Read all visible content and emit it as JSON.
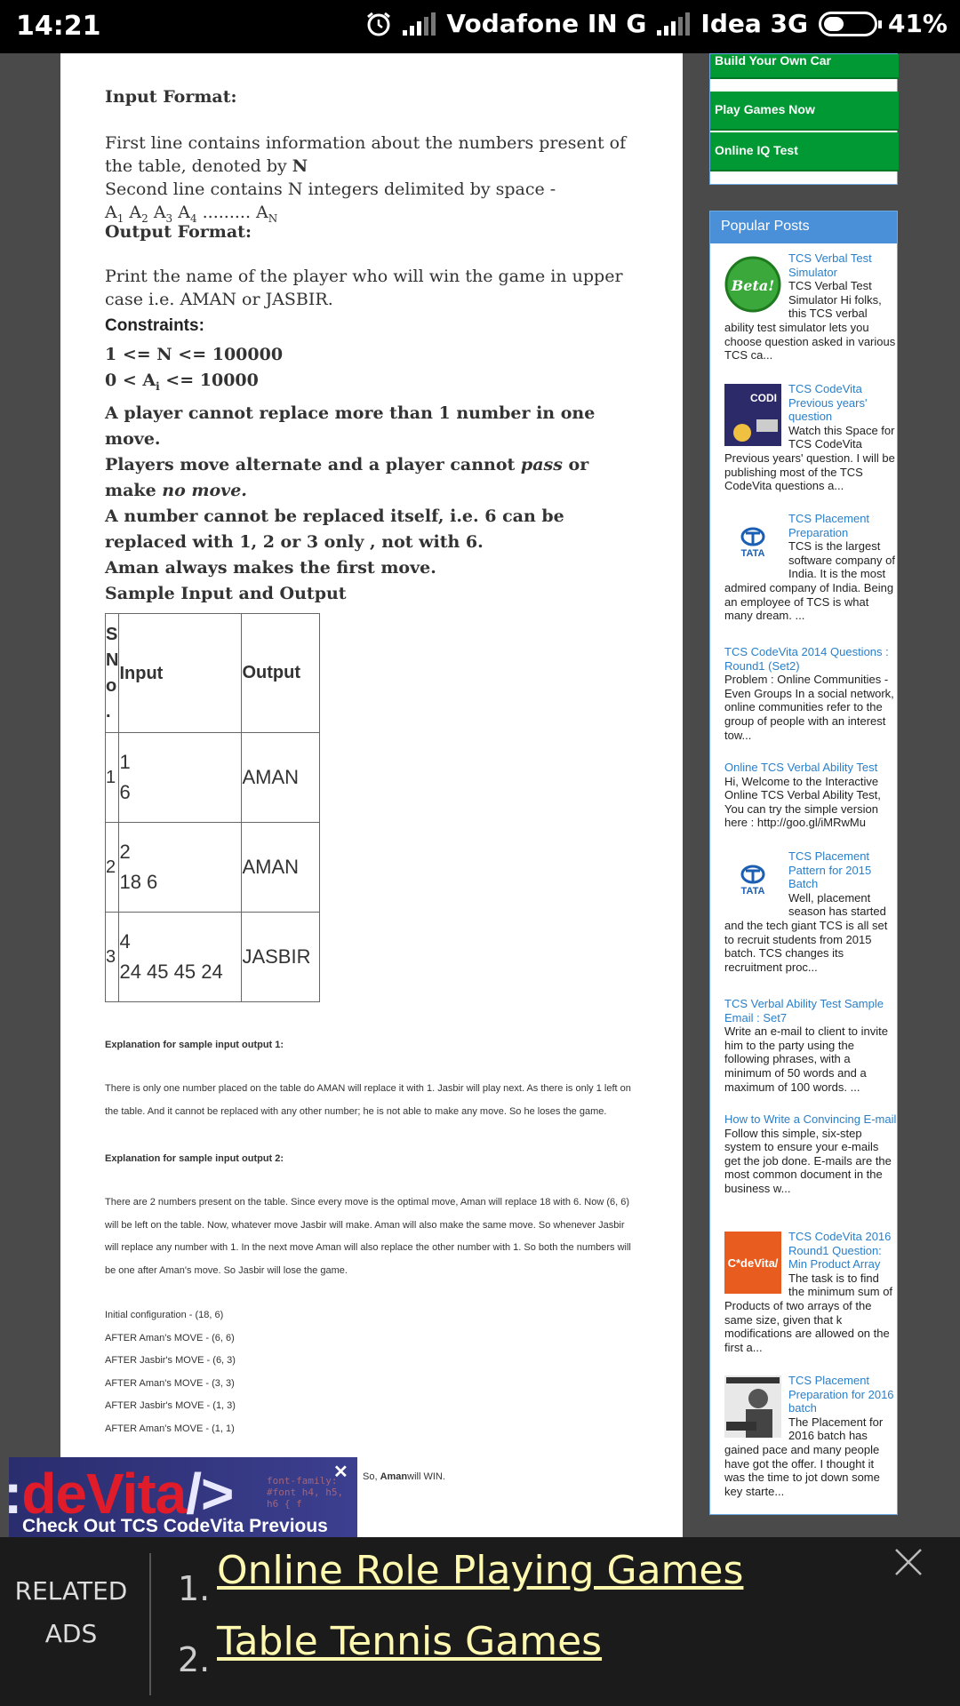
{
  "status_bar": {
    "time": "14:21",
    "carrier1": "Vodafone IN G",
    "carrier2": "Idea 3G",
    "battery": "41%",
    "battery_level": 0.41,
    "icons": [
      "alarm-icon",
      "signal-icon",
      "battery-icon"
    ]
  },
  "article": {
    "input_format_heading": "Input Format:",
    "input_line1": "First line contains information about the numbers present of the table, denoted by",
    "input_line1_var": "N",
    "input_line2": "Second line contains N integers delimited by space -",
    "input_line3": "A1 A2 A3 A4 ......... AN",
    "output_format_heading": "Output Format:",
    "output_text": "Print the name of the player who will win the game in upper case i.e. AMAN or JASBIR.",
    "constraints_heading": "Constraints:",
    "constraint1": "1 <= N <= 100000",
    "constraint2": "0 < Ai <= 10000",
    "constraint3": "A player cannot replace more than 1 number in one move.",
    "constraint4_a": "Players move alternate and a player cannot",
    "constraint4_pass": "pass",
    "constraint4_b": "or make",
    "constraint4_nomove": "no move.",
    "constraint5": "A number cannot be replaced itself, i.e. 6 can be replaced with 1, 2 or 3 only , not with 6.",
    "constraint6": "Aman always makes the first move.",
    "sample_heading": "Sample Input and Output",
    "table": {
      "headers": [
        "S N o .",
        "Input",
        "Output"
      ],
      "rows": [
        {
          "sno": "1",
          "input_line1": "1",
          "input_line2": "6",
          "output": "AMAN"
        },
        {
          "sno": "2",
          "input_line1": "2",
          "input_line2": "18 6",
          "output": "AMAN"
        },
        {
          "sno": "3",
          "input_line1": "4",
          "input_line2": "24 45 45 24",
          "output": "JASBIR"
        }
      ]
    },
    "expl1_heading": "Explanation for sample input output 1:",
    "expl1_text": "There is only one number placed on the table do AMAN will replace it with 1. Jasbir will play next. As there is only 1 left on the table. And it cannot be replaced with any other number; he is not able to make any move. So he loses the game.",
    "expl2_heading": "Explanation for sample input output 2:",
    "expl2_text": "There are 2 numbers present on the table. Since every move is the optimal move, Aman will replace 18 with 6. Now (6, 6) will be left on the table. Now, whatever move Jasbir will make. Aman will also make the same move. So whenever Jasbir will replace any number with 1. In the next move Aman will also replace the other number with 1. So both the numbers will be one after Aman's move. So Jasbir will lose the game.",
    "moves": [
      "Initial configuration - (18, 6)",
      "AFTER Aman's MOVE - (6, 6)",
      "AFTER Jasbir's MOVE - (6, 3)",
      "AFTER Aman's MOVE - (3, 3)",
      "AFTER Jasbir's MOVE - (1, 3)",
      "AFTER Aman's MOVE - (1, 1)"
    ],
    "conclusion_a": "So,",
    "conclusion_name": "Aman",
    "conclusion_b": "will WIN."
  },
  "sidebar": {
    "green_links": [
      "Build Your Own Car",
      "Play Games Now",
      "Online IQ Test"
    ],
    "popular_heading": "Popular Posts",
    "posts": [
      {
        "title": "TCS Verbal Test Simulator",
        "snippet": "TCS Verbal Test Simulator     Hi folks, this TCS verbal ability test simulator lets you choose question asked in various TCS ca...",
        "thumb_text": "Beta!"
      },
      {
        "title": "TCS CodeVita Previous years' question",
        "snippet": "Watch this Space for TCS CodeVita Previous years' question. I will be publishing most of the TCS CodeVita questions a...",
        "thumb_text": "CODI"
      },
      {
        "title": "TCS Placement Preparation",
        "snippet": "TCS is the largest software company of India. It is the most admired company of India. Being an employee of TCS is what many dream. ...",
        "thumb_text": "TATA"
      },
      {
        "title": "TCS CodeVita 2014 Questions : Round1 (Set2)",
        "snippet": "Problem : Online Communities - Even Groups In a social network, online communities refer to the group of people with an interest tow..."
      },
      {
        "title": "Online TCS Verbal Ability Test",
        "snippet": "Hi, Welcome to the Interactive Online TCS Verbal Ability Test, You can try the simple version here : http://goo.gl/iMRwMu"
      },
      {
        "title": "TCS Placement Pattern for 2015 Batch",
        "snippet": "Well, placement season has started and the tech giant TCS is all set to recruit students from 2015 batch. TCS changes its recruitment proc...",
        "thumb_text": "TATA"
      },
      {
        "title": "TCS Verbal Ability Test Sample Email : Set7",
        "snippet": "Write an e-mail to client to invite him to the party using the following phrases, with a minimum of 50 words and a maximum of 100 words. ..."
      },
      {
        "title": "How to Write a Convincing E-mail",
        "snippet": "Follow this simple, six-step system to ensure your e-mails get the job done. E-mails are the most common document in the business w..."
      },
      {
        "title": "TCS CodeVita 2016 Round1 Question: Min Product Array",
        "snippet": "The task is to find the minimum sum of Products of two arrays of the same size, given that k modifications are allowed on the first a...",
        "thumb_text": "C*deVita/"
      },
      {
        "title": "TCS Placement Preparation for 2016 batch",
        "snippet": "The Placement for 2016 batch has gained pace and many people have got the offer. I thought it was the time to jot down some key starte..."
      }
    ]
  },
  "video_ad": {
    "big_text_red": "deVita",
    "big_text": "/>",
    "caption": "Check Out TCS CodeVita Previous",
    "code_text": "font-family: #font h4, h5, h6 { f"
  },
  "related_ads": {
    "label_line1": "RELATED",
    "label_line2": "ADS",
    "items": [
      {
        "number": "1.",
        "text": "Online Role Playing Games"
      },
      {
        "number": "2.",
        "text": "Table Tennis Games"
      }
    ]
  }
}
